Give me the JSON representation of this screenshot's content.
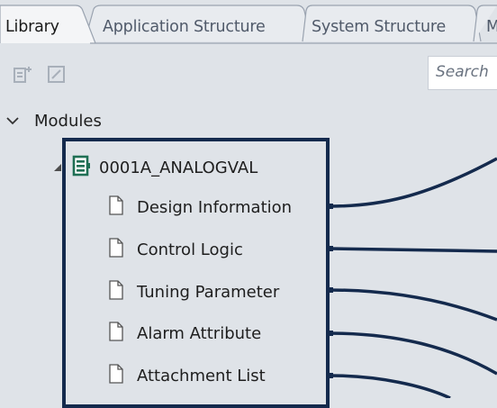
{
  "tabs": [
    {
      "label": "Library",
      "active": true
    },
    {
      "label": "Application Structure",
      "active": false
    },
    {
      "label": "System Structure",
      "active": false
    },
    {
      "label": "M",
      "active": false
    }
  ],
  "toolbar": {
    "icons": [
      "add-module-icon",
      "edit-icon"
    ],
    "search_placeholder": "Search"
  },
  "tree": {
    "root": {
      "label": "Modules",
      "expanded": true
    },
    "module": {
      "label": "0001A_ANALOGVAL",
      "expanded": true,
      "icon": "module-icon"
    },
    "items": [
      {
        "label": "Design Information",
        "icon": "document-icon"
      },
      {
        "label": "Control Logic",
        "icon": "document-icon"
      },
      {
        "label": "Tuning Parameter",
        "icon": "document-icon"
      },
      {
        "label": "Alarm Attribute",
        "icon": "document-icon"
      },
      {
        "label": "Attachment List",
        "icon": "document-icon"
      }
    ]
  },
  "colors": {
    "background": "#dfe3e8",
    "highlight": "#142a4d",
    "module_icon": "#1f6f54",
    "tab_text_inactive": "#505a6a"
  }
}
